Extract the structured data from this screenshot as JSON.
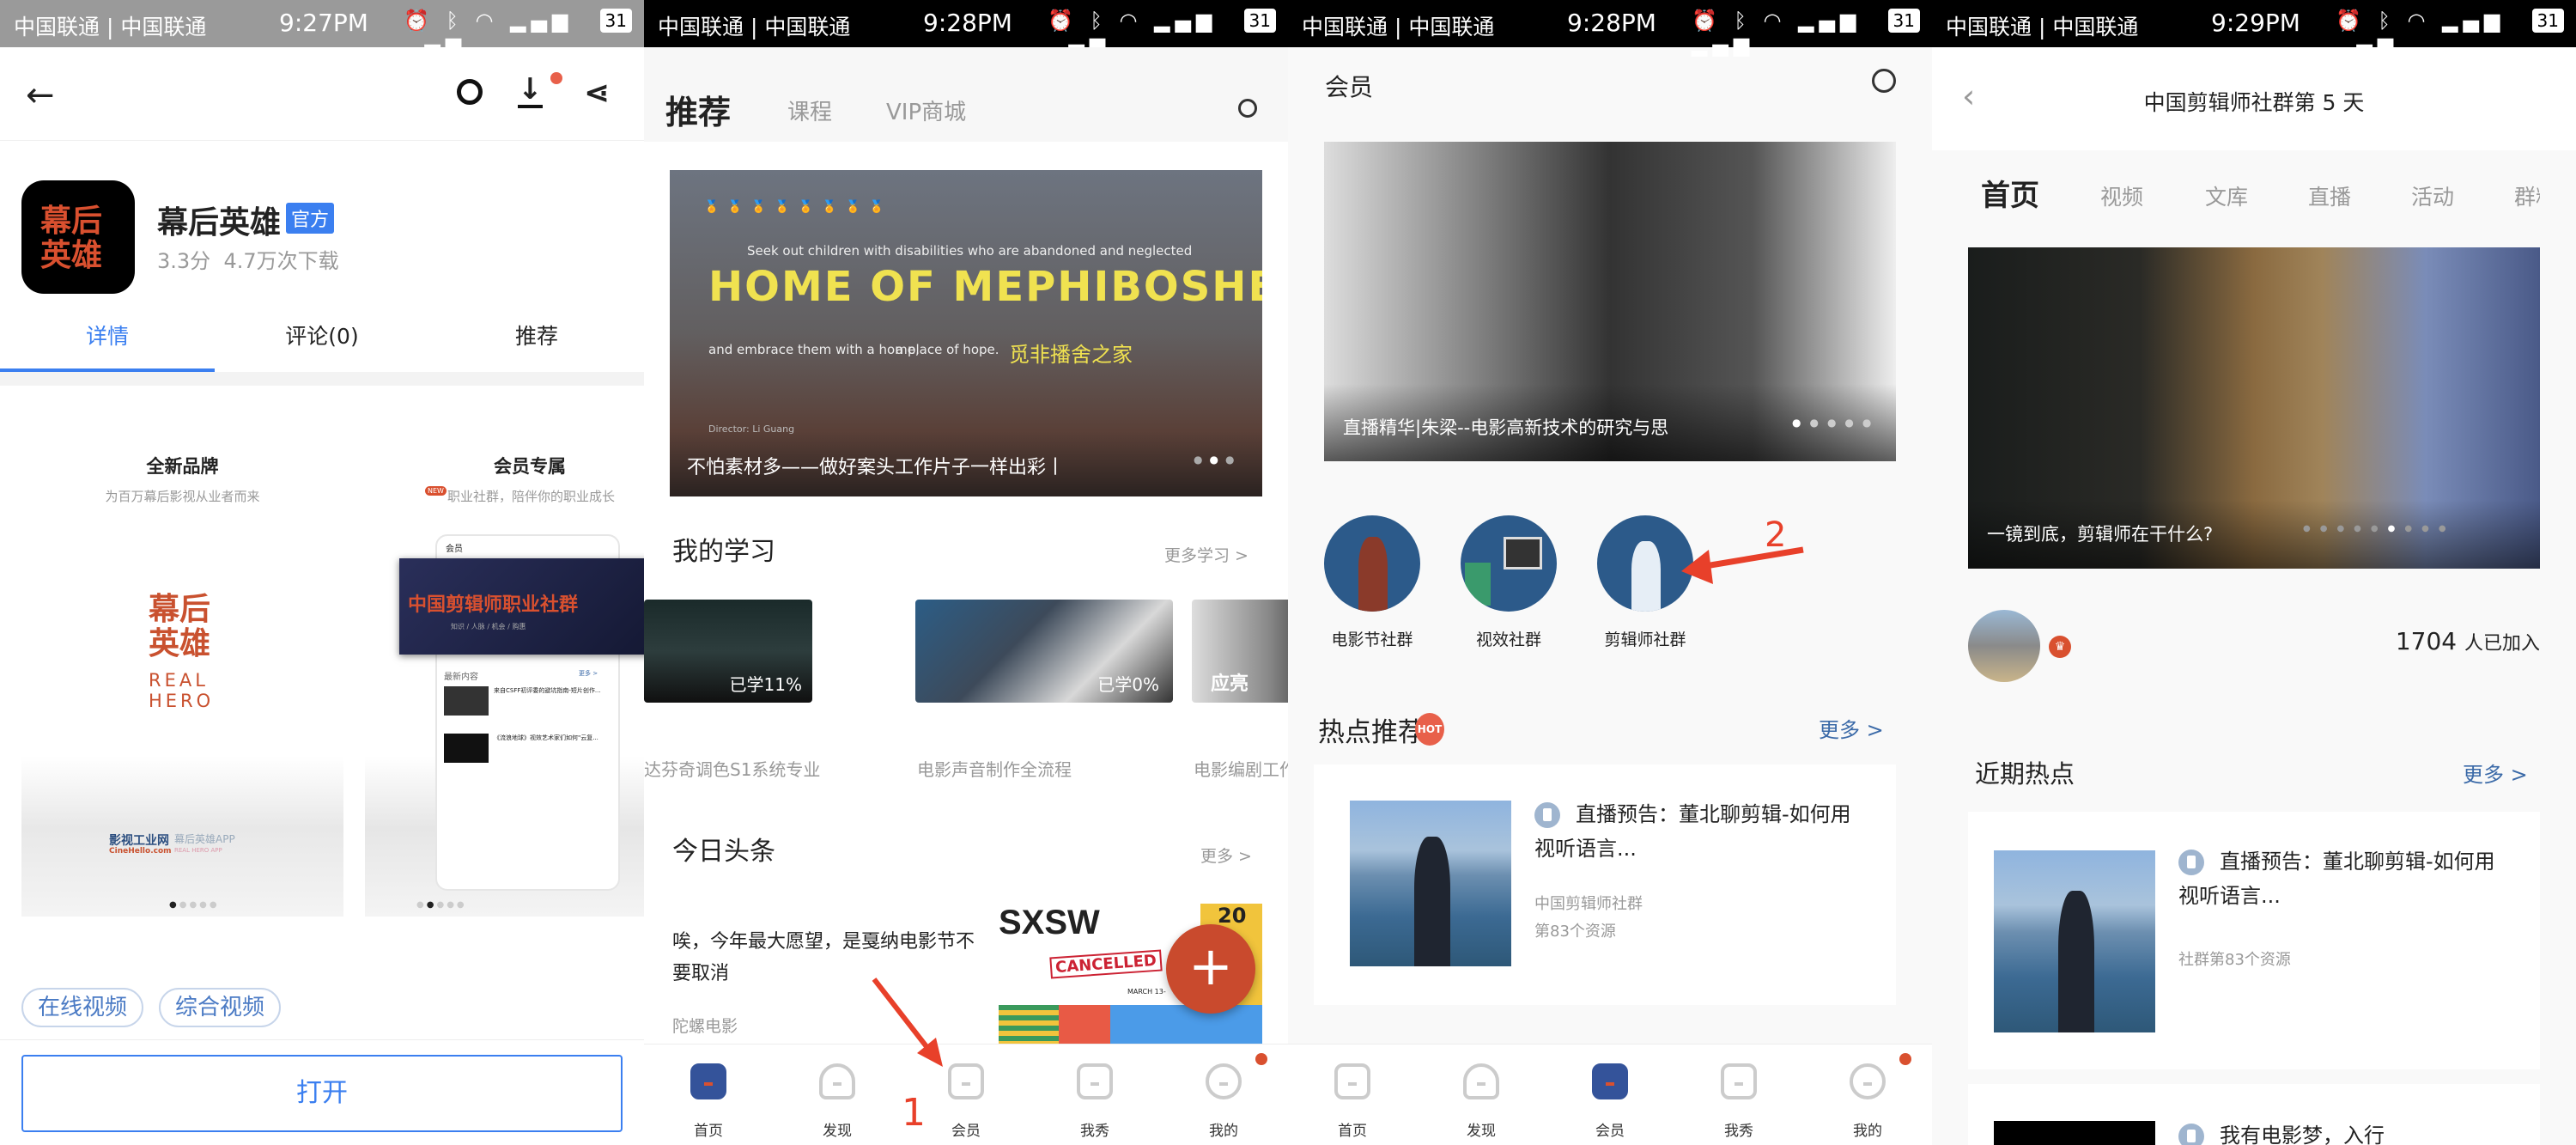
{
  "status_bars": [
    {
      "carrier": "中国联通 | 中国联通",
      "time": "9:27PM",
      "battery": "31"
    },
    {
      "carrier": "中国联通 | 中国联通",
      "time": "9:28PM",
      "battery": "31"
    },
    {
      "carrier": "中国联通 | 中国联通",
      "time": "9:28PM",
      "battery": "31"
    },
    {
      "carrier": "中国联通 | 中国联通",
      "time": "9:29PM",
      "battery": "31"
    }
  ],
  "bottom_nav": [
    "首页",
    "发现",
    "会员",
    "我秀",
    "我的"
  ],
  "colors": {
    "accent_blue": "#3b7ff0",
    "nav_active": "#34539a",
    "brand_red": "#d9502f",
    "link_blue": "#3b6aa8"
  },
  "p1": {
    "app_name": "幕后英雄",
    "icon_text": "幕后英雄",
    "badge": "官方",
    "rating": "3.3分",
    "downloads": "4.7万次下载",
    "tabs": [
      "详情",
      "评论(0)",
      "推荐"
    ],
    "card1": {
      "title": "全新品牌",
      "subtitle": "为百万幕后影视从业者而来",
      "logo_cn": "幕后英雄",
      "logo_en": "REAL HERO",
      "brand": "影视工业网",
      "site": "CineHello.com",
      "app": "幕后英雄APP",
      "app_en": "REAL HERO APP"
    },
    "card2": {
      "title": "会员专属",
      "new_badge": "NEW",
      "subtitle": "职业社群，陪伴你的职业成长",
      "mock_header": "会员",
      "mock_banner": "中国剪辑师职业社群",
      "mock_banner_sub": "知识 / 人脉 / 机会 / 购惠",
      "mock_section": "最新内容",
      "mock_more": "更多 >",
      "mock_items": [
        "来自CSFF初评委的避坑指南-短片创作...",
        "《流浪地球》视效艺术家们如何\"云复..."
      ]
    },
    "tags": [
      "在线视频",
      "综合视频"
    ],
    "open_button": "打开"
  },
  "p2": {
    "tabs": [
      "推荐",
      "课程",
      "VIP商城"
    ],
    "banner": {
      "tagline": "Seek out children with disabilities who are abandoned and neglected",
      "title": "HOME OF MEPHIBOSHETH",
      "line2a": "and embrace them with a home,",
      "line2b": "a place of hope.",
      "title_cn": "觅非播舍之家",
      "director": "Director:  Li Guang",
      "caption": "不怕素材多——做好案头工作片子一样出彩丨"
    },
    "study_title": "我的学习",
    "study_more": "更多学习 >",
    "courses": [
      {
        "title": "达芬奇调色S1系统专业",
        "progress": "已学11%"
      },
      {
        "title": "电影声音制作全流程",
        "progress": "已学0%"
      },
      {
        "title": "电影编剧工作",
        "progress": "",
        "overlay": "应亮"
      }
    ],
    "news_title": "今日头条",
    "news_more": "更多 >",
    "article": {
      "title": "唉，今年最大愿望，是戛纳电影节不要取消",
      "source": "陀螺电影",
      "img_text": "SXSW",
      "img_stamp": "CANCELLED",
      "img_date": "MARCH 13-",
      "img_num": "20"
    },
    "annotation": "1"
  },
  "p3": {
    "title": "会员",
    "banner_caption": "直播精华|朱梁--电影高新技术的研究与思",
    "communities": [
      "电影节社群",
      "视效社群",
      "剪辑师社群"
    ],
    "annotation": "2",
    "hot_title": "热点推荐",
    "hot_badge": "HOT",
    "hot_more": "更多 >",
    "item": {
      "title": "直播预告：董北聊剪辑-如何用视听语言...",
      "group": "中国剪辑师社群",
      "meta": "第83个资源"
    }
  },
  "p4": {
    "title": "中国剪辑师社群第 5 天",
    "tabs": [
      "首页",
      "视频",
      "文库",
      "直播",
      "活动",
      "群料"
    ],
    "banner_caption": "一镜到底，剪辑师在干什么?",
    "members_count": "1704",
    "members_label": "人已加入",
    "recent_title": "近期热点",
    "recent_more": "更多 >",
    "items": [
      {
        "title": "直播预告：董北聊剪辑-如何用视听语言...",
        "meta": "社群第83个资源"
      },
      {
        "title": "我有电影梦，入行"
      }
    ]
  }
}
